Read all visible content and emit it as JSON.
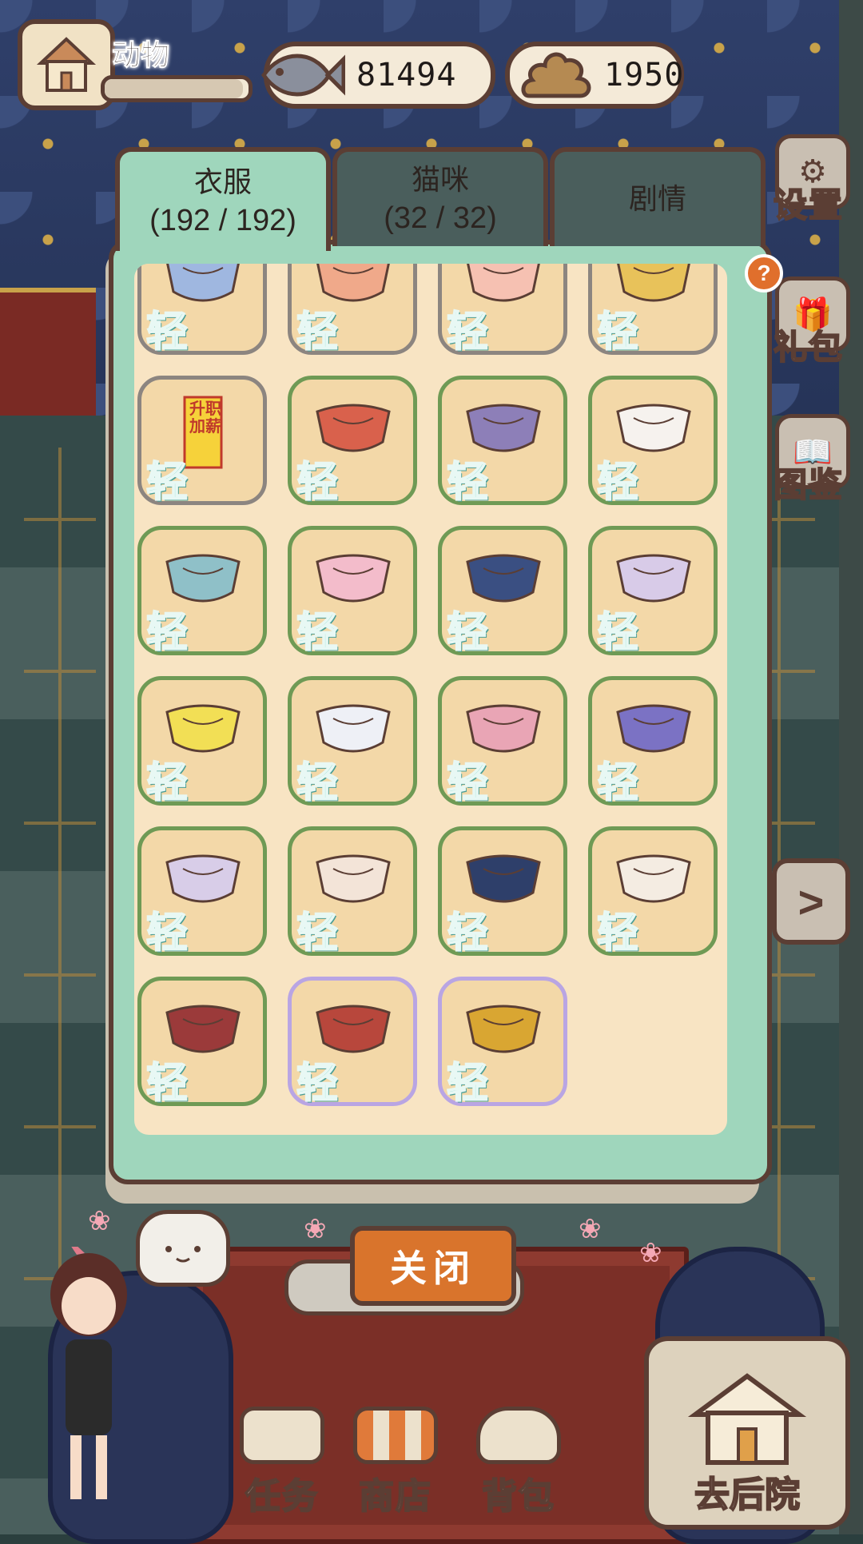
{
  "hud": {
    "title": "动物",
    "fish_count": "81494",
    "poop_count": "1950",
    "progress": 0.96
  },
  "tabs": [
    {
      "label": "衣服",
      "count": "(192 / 192)",
      "active": true
    },
    {
      "label": "猫咪",
      "count": "(32 / 32)",
      "active": false
    },
    {
      "label": "剧情",
      "count": "",
      "active": false
    }
  ],
  "side": {
    "settings": "设置",
    "gift": "礼包",
    "catalog": "图鉴",
    "help": "?",
    "next": ">"
  },
  "items": [
    {
      "name": "blue-bow-collar",
      "badge": "轻",
      "border": "gray"
    },
    {
      "name": "pig-nose-mask",
      "badge": "轻",
      "border": "gray"
    },
    {
      "name": "pacifier",
      "badge": "轻",
      "border": "gray"
    },
    {
      "name": "helmet-goggles",
      "badge": "轻",
      "border": "gray"
    },
    {
      "name": "promotion-talisman",
      "badge": "轻",
      "border": "gray",
      "text": "升职加薪"
    },
    {
      "name": "red-cape-collar",
      "badge": "轻",
      "border": "green"
    },
    {
      "name": "purple-shorts",
      "badge": "轻",
      "border": "green"
    },
    {
      "name": "white-lace-top",
      "badge": "轻",
      "border": "green"
    },
    {
      "name": "blue-sailor-outfit",
      "badge": "轻",
      "border": "green"
    },
    {
      "name": "pink-hoodie",
      "badge": "轻",
      "border": "green"
    },
    {
      "name": "striped-denim-overalls",
      "badge": "轻",
      "border": "green"
    },
    {
      "name": "lavender-paw-outfit",
      "badge": "轻",
      "border": "green"
    },
    {
      "name": "yellow-frill-dress",
      "badge": "轻",
      "border": "green"
    },
    {
      "name": "white-blue-skirt",
      "badge": "轻",
      "border": "green"
    },
    {
      "name": "pink-cream-outfit",
      "badge": "轻",
      "border": "green"
    },
    {
      "name": "purple-knit-sweater",
      "badge": "轻",
      "border": "green"
    },
    {
      "name": "lilac-fur-coat",
      "badge": "轻",
      "border": "green"
    },
    {
      "name": "cream-sheep-cape",
      "badge": "轻",
      "border": "green"
    },
    {
      "name": "navy-ruffle-dress",
      "badge": "轻",
      "border": "green"
    },
    {
      "name": "cream-sweater",
      "badge": "轻",
      "border": "green"
    },
    {
      "name": "maroon-ruffle-dress",
      "badge": "轻",
      "border": "green"
    },
    {
      "name": "red-knit-set",
      "badge": "轻",
      "border": "purple"
    },
    {
      "name": "golden-chain-collar",
      "badge": "轻",
      "border": "purple"
    }
  ],
  "close_label": "关闭",
  "nav": {
    "tasks": "任务",
    "shop": "商店",
    "bag": "背包",
    "backyard": "去后院"
  },
  "colors": {
    "panel": "#9fd6bc",
    "grid_bg": "#f8e4c3",
    "item_bg": "#f3d8a8",
    "border_green": "#6f9a55",
    "border_gray": "#8c8580",
    "border_purple": "#b9a5e3",
    "badge": "#7fd3c9",
    "close_button": "#d9742c",
    "outline": "#5b3e34"
  }
}
